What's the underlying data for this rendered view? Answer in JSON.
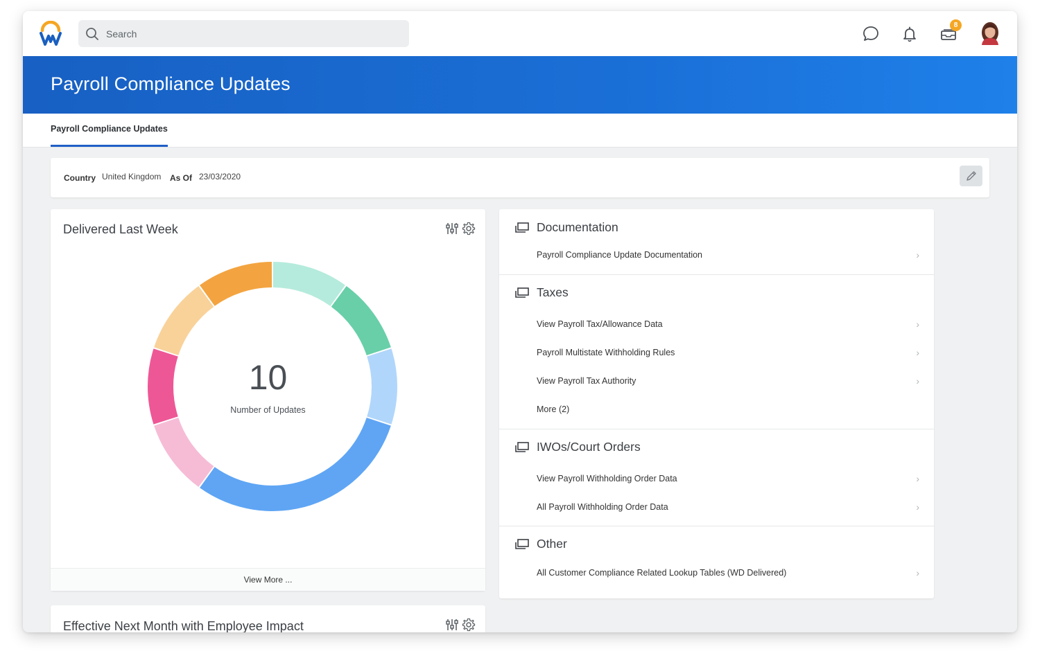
{
  "header": {
    "search_placeholder": "Search",
    "inbox_badge": "8",
    "icons": [
      "chat-icon",
      "bell-icon",
      "inbox-icon"
    ]
  },
  "banner": {
    "title": "Payroll Compliance Updates"
  },
  "tabs": [
    {
      "label": "Payroll Compliance Updates",
      "active": true
    }
  ],
  "prompts": {
    "country_label": "Country",
    "country_value": "United Kingdom",
    "asof_label": "As Of",
    "asof_value": "23/03/2020"
  },
  "delivered_card": {
    "title": "Delivered Last Week",
    "center_value": "10",
    "center_label": "Number of Updates",
    "view_more": "View More ..."
  },
  "next_month_card": {
    "title": "Effective Next Month with Employee Impact"
  },
  "chart_data": {
    "type": "pie",
    "title": "Delivered Last Week",
    "segments": [
      {
        "value": 1,
        "color": "#b5ebdc"
      },
      {
        "value": 1,
        "color": "#68cfa9"
      },
      {
        "value": 1,
        "color": "#b1d6fb"
      },
      {
        "value": 3,
        "color": "#5fa5f4"
      },
      {
        "value": 1,
        "color": "#f6bcd6"
      },
      {
        "value": 1,
        "color": "#ee5796"
      },
      {
        "value": 1,
        "color": "#f9d29a"
      },
      {
        "value": 1,
        "color": "#f3a440"
      }
    ],
    "total": 10
  },
  "related": {
    "sections": [
      {
        "title": "Documentation",
        "links": [
          "Payroll Compliance Update Documentation"
        ]
      },
      {
        "title": "Taxes",
        "links": [
          "View Payroll Tax/Allowance Data",
          "Payroll Multistate Withholding Rules",
          "View Payroll Tax Authority"
        ],
        "more": "More (2)"
      },
      {
        "title": "IWOs/Court Orders",
        "links": [
          "View Payroll Withholding Order Data",
          "All Payroll Withholding Order Data"
        ]
      },
      {
        "title": "Other",
        "links": [
          "All Customer Compliance Related Lookup Tables (WD Delivered)"
        ]
      }
    ]
  },
  "colors": {
    "brand_blue": "#1a6fd6",
    "tab_underline": "#1f5fc6",
    "badge": "#f5a623"
  }
}
